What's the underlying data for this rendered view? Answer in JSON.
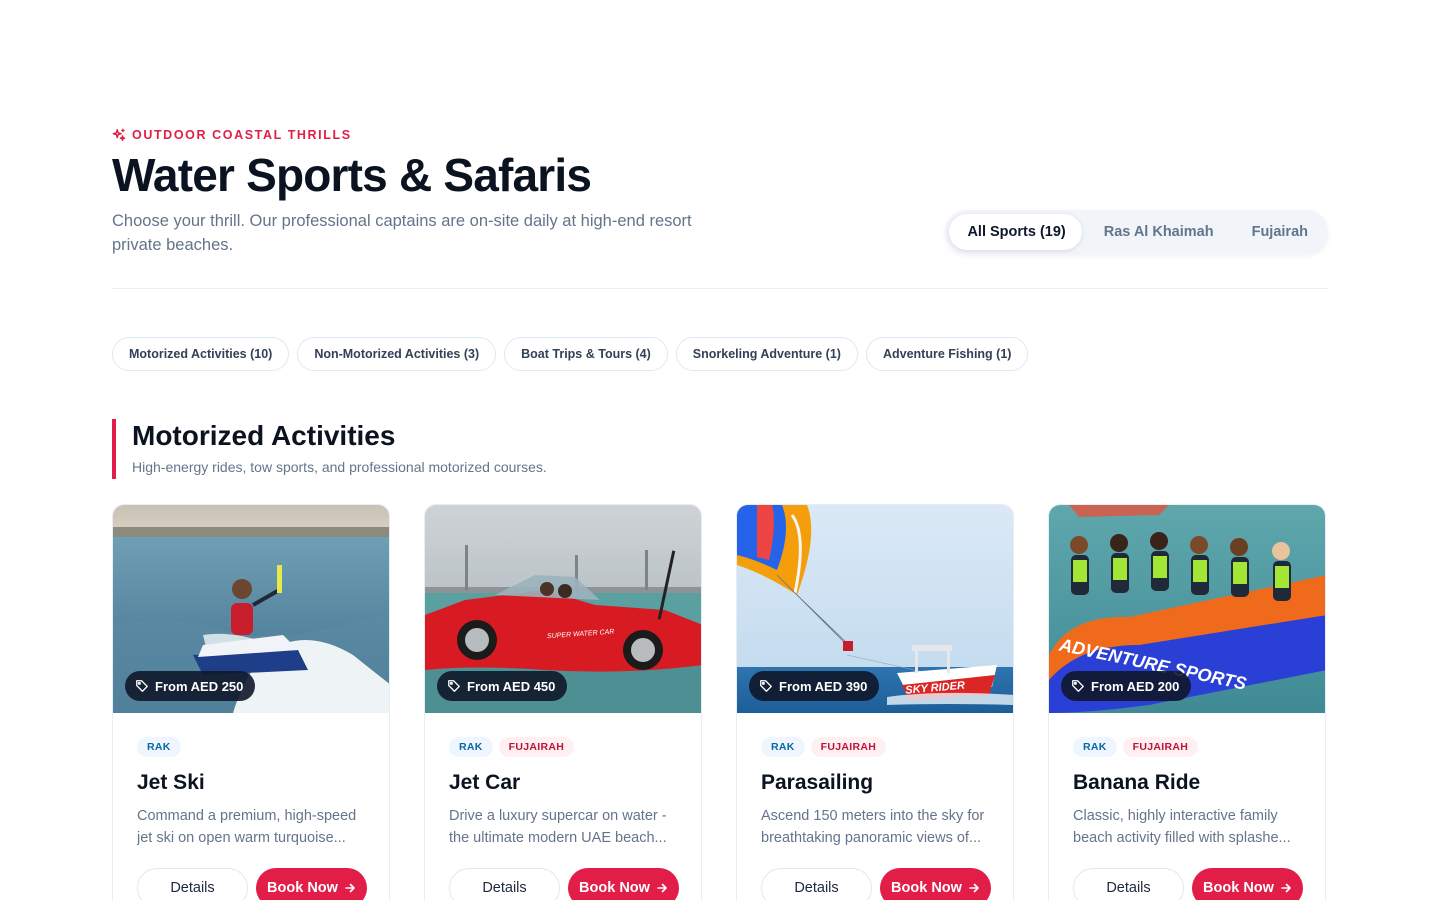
{
  "header": {
    "eyebrow": "OUTDOOR COASTAL THRILLS",
    "title": "Water Sports & Safaris",
    "subtitle": "Choose your thrill. Our professional captains are on-site daily at high-end resort private beaches."
  },
  "location_tabs": [
    {
      "label": "All Sports (19)",
      "active": true
    },
    {
      "label": "Ras Al Khaimah",
      "active": false
    },
    {
      "label": "Fujairah",
      "active": false
    }
  ],
  "category_chips": [
    "Motorized Activities (10)",
    "Non-Motorized Activities (3)",
    "Boat Trips & Tours (4)",
    "Snorkeling Adventure (1)",
    "Adventure Fishing (1)"
  ],
  "section": {
    "title": "Motorized Activities",
    "subtitle": "High-energy rides, tow sports, and professional motorized courses."
  },
  "cards": [
    {
      "price": "From AED 250",
      "tags": [
        "RAK"
      ],
      "title": "Jet Ski",
      "description": "Command a premium, high-speed jet ski on open warm turquoise...",
      "details_label": "Details",
      "book_label": "Book Now"
    },
    {
      "price": "From AED 450",
      "tags": [
        "RAK",
        "FUJAIRAH"
      ],
      "title": "Jet Car",
      "description": "Drive a luxury supercar on water - the ultimate modern UAE beach...",
      "details_label": "Details",
      "book_label": "Book Now"
    },
    {
      "price": "From AED 390",
      "tags": [
        "RAK",
        "FUJAIRAH"
      ],
      "title": "Parasailing",
      "description": "Ascend 150 meters into the sky for breathtaking panoramic views of...",
      "details_label": "Details",
      "book_label": "Book Now"
    },
    {
      "price": "From AED 200",
      "tags": [
        "RAK",
        "FUJAIRAH"
      ],
      "title": "Banana Ride",
      "description": "Classic, highly interactive family beach activity filled with splashe...",
      "details_label": "Details",
      "book_label": "Book Now"
    }
  ],
  "images": {
    "jet_ski_photo_text": "",
    "jet_car_photo_text": "SUPER WATER CAR",
    "parasail_boat_text": "SKY RIDER",
    "banana_boat_text": "ADVENTURE SPORTS"
  },
  "colors": {
    "accent": "#e11d48",
    "text_dark": "#0b1220",
    "muted": "#64748b",
    "tag_rak_text": "#0369a1",
    "tag_fujairah_text": "#be123c"
  },
  "icons": {
    "eyebrow": "sparkle-icon",
    "price": "tag-icon",
    "book": "arrow-right-icon"
  }
}
